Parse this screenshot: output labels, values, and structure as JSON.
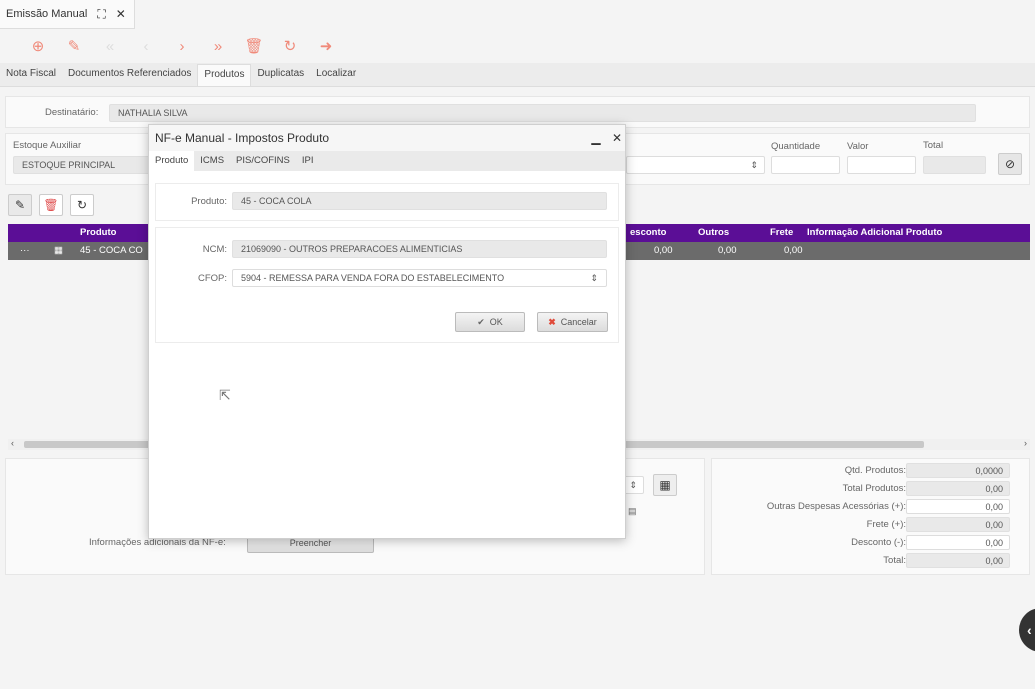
{
  "window_tab": {
    "title": "Emissão Manual"
  },
  "main_tabs": [
    "Nota Fiscal",
    "Documentos Referenciados",
    "Produtos",
    "Duplicatas",
    "Localizar"
  ],
  "destinatario": {
    "label": "Destinatário:",
    "value": "NATHALIA SILVA"
  },
  "estoque": {
    "label": "Estoque Auxiliar",
    "value": "ESTOQUE PRINCIPAL"
  },
  "qty_labels": {
    "quantidade": "Quantidade",
    "valor": "Valor",
    "total": "Total"
  },
  "grid": {
    "headers": {
      "produto": "Produto",
      "desconto": "esconto",
      "outros": "Outros",
      "frete": "Frete",
      "info": "Informação Adicional Produto"
    },
    "row": {
      "dots": "···",
      "produto": "45 - COCA CO",
      "desconto": "0,00",
      "outros": "0,00",
      "frete": "0,00"
    }
  },
  "info_adicionais": {
    "label": "Informações adicionais da NF-e:",
    "button": "Preencher"
  },
  "totals": [
    {
      "label": "Qtd. Produtos:",
      "value": "0,0000",
      "editable": false
    },
    {
      "label": "Total Produtos:",
      "value": "0,00",
      "editable": false
    },
    {
      "label": "Outras Despesas Acessórias (+):",
      "value": "0,00",
      "editable": true
    },
    {
      "label": "Frete (+):",
      "value": "0,00",
      "editable": false
    },
    {
      "label": "Desconto (-):",
      "value": "0,00",
      "editable": true
    },
    {
      "label": "Total:",
      "value": "0,00",
      "editable": false
    }
  ],
  "modal": {
    "title": "NF-e Manual - Impostos Produto",
    "tabs": [
      "Produto",
      "ICMS",
      "PIS/COFINS",
      "IPI"
    ],
    "produto": {
      "label": "Produto:",
      "value": "45 - COCA COLA"
    },
    "ncm": {
      "label": "NCM:",
      "value": "21069090 - OUTROS PREPARACOES ALIMENTICIAS"
    },
    "cfop": {
      "label": "CFOP:",
      "value": "5904 - REMESSA PARA VENDA FORA DO ESTABELECIMENTO"
    },
    "ok": "OK",
    "cancel": "Cancelar"
  },
  "colors": {
    "accent": "#f08a7a",
    "grid_header": "#5b0e96",
    "grid_row": "#6b6b6b"
  }
}
